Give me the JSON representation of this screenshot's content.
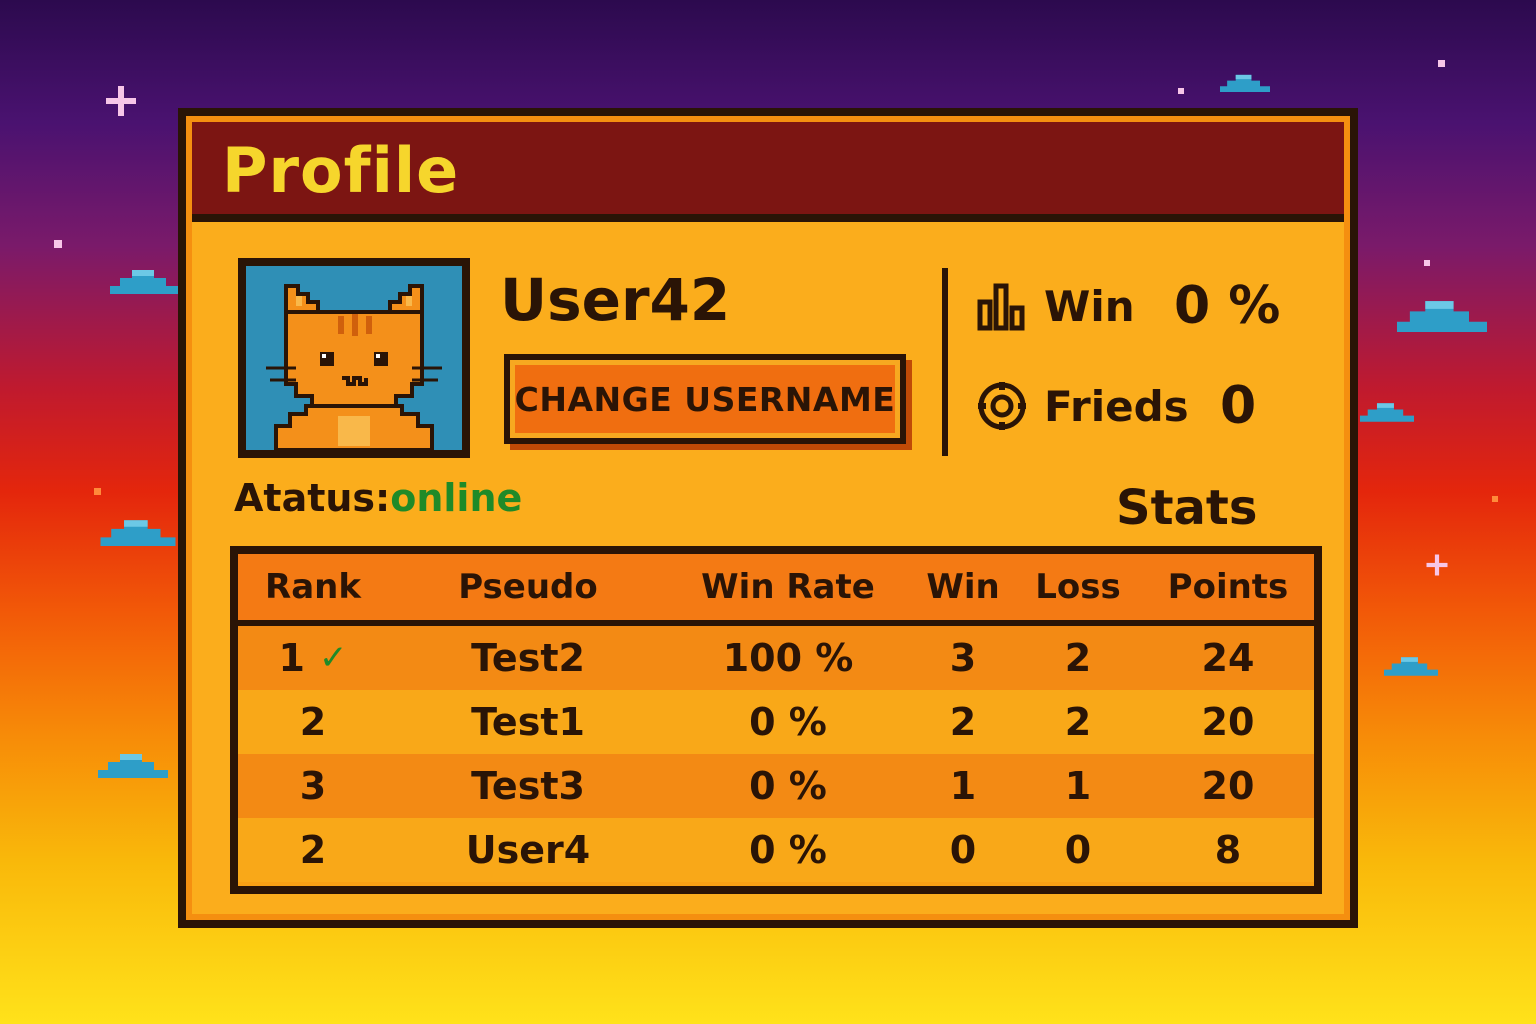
{
  "window": {
    "title": "Profile"
  },
  "profile": {
    "username": "User42",
    "change_button": "CHANGE USERNAME",
    "status_label": "Atatus:",
    "status_value": "online",
    "status_color": "#1f8a28"
  },
  "summary": {
    "win": {
      "icon": "bar-chart-icon",
      "label": "Win",
      "value": "0 %"
    },
    "friends": {
      "icon": "friends-icon",
      "label": "Frieds",
      "value": "0"
    }
  },
  "stats": {
    "title": "Stats",
    "columns": [
      "Rank",
      "Pseudo",
      "Win Rate",
      "Win",
      "Loss",
      "Points"
    ],
    "rows": [
      {
        "rank": "1",
        "check": "✓",
        "pseudo": "Test2",
        "win_rate": "100 %",
        "win": "3",
        "loss": "2",
        "points": "24"
      },
      {
        "rank": "2",
        "pseudo": "Test1",
        "win_rate": "0 %",
        "win": "2",
        "loss": "2",
        "points": "20"
      },
      {
        "rank": "3",
        "pseudo": "Test3",
        "win_rate": "0 %",
        "win": "1",
        "loss": "1",
        "points": "20"
      },
      {
        "rank": "2",
        "pseudo": "User4",
        "win_rate": "0 %",
        "win": "0",
        "loss": "0",
        "points": "8"
      }
    ]
  },
  "colors": {
    "panel": "#fbad1c",
    "title_bar": "#7c1512",
    "title_text": "#f6d62c",
    "outline": "#2a1406",
    "button": "#f06e10",
    "avatar_bg": "#2f8fb6"
  }
}
